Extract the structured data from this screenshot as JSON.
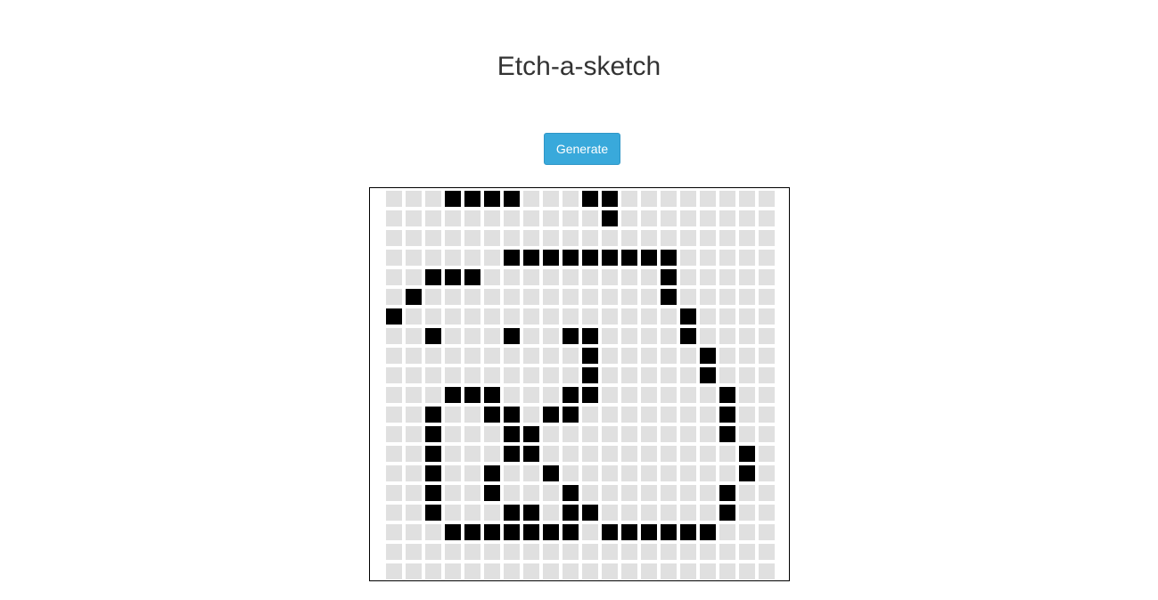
{
  "page": {
    "title": "Etch-a-sketch"
  },
  "toolbar": {
    "generate_label": "Generate"
  },
  "colors": {
    "accent": "#39a9db",
    "cell_off": "#e0e0e0",
    "cell_on": "#000000"
  },
  "grid": {
    "rows": 20,
    "cols": 20,
    "filled": [
      [
        0,
        3
      ],
      [
        0,
        4
      ],
      [
        0,
        5
      ],
      [
        0,
        6
      ],
      [
        0,
        10
      ],
      [
        0,
        11
      ],
      [
        1,
        11
      ],
      [
        3,
        6
      ],
      [
        3,
        7
      ],
      [
        3,
        8
      ],
      [
        3,
        9
      ],
      [
        3,
        10
      ],
      [
        3,
        11
      ],
      [
        3,
        12
      ],
      [
        3,
        13
      ],
      [
        3,
        14
      ],
      [
        4,
        2
      ],
      [
        4,
        3
      ],
      [
        4,
        4
      ],
      [
        4,
        14
      ],
      [
        5,
        1
      ],
      [
        5,
        14
      ],
      [
        6,
        0
      ],
      [
        6,
        15
      ],
      [
        7,
        2
      ],
      [
        7,
        6
      ],
      [
        7,
        9
      ],
      [
        7,
        10
      ],
      [
        7,
        15
      ],
      [
        8,
        10
      ],
      [
        8,
        16
      ],
      [
        9,
        10
      ],
      [
        9,
        16
      ],
      [
        10,
        3
      ],
      [
        10,
        4
      ],
      [
        10,
        5
      ],
      [
        10,
        9
      ],
      [
        10,
        10
      ],
      [
        10,
        17
      ],
      [
        11,
        2
      ],
      [
        11,
        5
      ],
      [
        11,
        6
      ],
      [
        11,
        8
      ],
      [
        11,
        9
      ],
      [
        11,
        17
      ],
      [
        12,
        2
      ],
      [
        12,
        6
      ],
      [
        12,
        7
      ],
      [
        12,
        17
      ],
      [
        13,
        2
      ],
      [
        13,
        6
      ],
      [
        13,
        7
      ],
      [
        13,
        18
      ],
      [
        14,
        2
      ],
      [
        14,
        5
      ],
      [
        14,
        8
      ],
      [
        14,
        18
      ],
      [
        15,
        2
      ],
      [
        15,
        5
      ],
      [
        15,
        9
      ],
      [
        15,
        17
      ],
      [
        16,
        2
      ],
      [
        16,
        6
      ],
      [
        16,
        7
      ],
      [
        16,
        9
      ],
      [
        16,
        10
      ],
      [
        16,
        17
      ],
      [
        17,
        3
      ],
      [
        17,
        4
      ],
      [
        17,
        5
      ],
      [
        17,
        6
      ],
      [
        17,
        7
      ],
      [
        17,
        8
      ],
      [
        17,
        9
      ],
      [
        17,
        11
      ],
      [
        17,
        12
      ],
      [
        17,
        13
      ],
      [
        17,
        14
      ],
      [
        17,
        15
      ],
      [
        17,
        16
      ]
    ]
  }
}
